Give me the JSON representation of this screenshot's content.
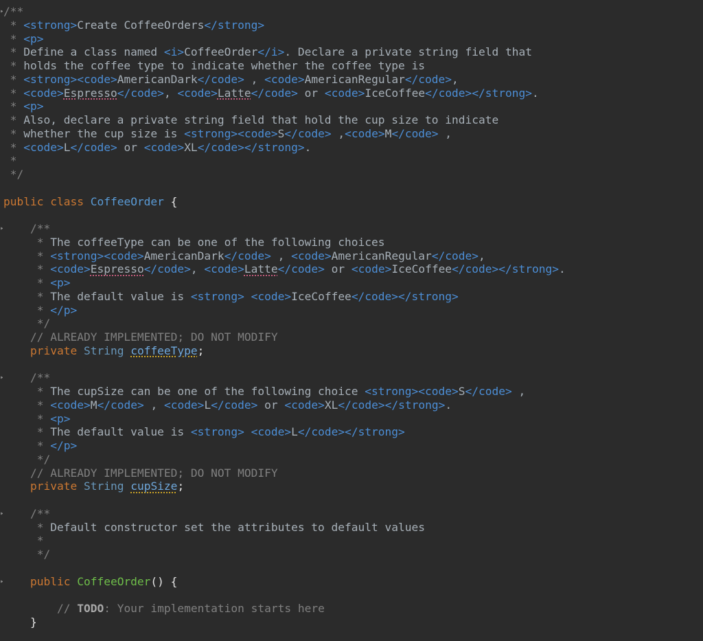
{
  "editor": {
    "lines": [
      "/**",
      " * <strong>Create CoffeeOrders</strong>",
      " * <p>",
      " * Define a class named <i>CoffeeOrder</i>. Declare a private string field that",
      " * holds the coffee type to indicate whether the coffee type is",
      " * <strong><code>AmericanDark</code> , <code>AmericanRegular</code>,",
      " * <code>Espresso</code>, <code>Latte</code> or <code>IceCoffee</code></strong>.",
      " * <p>",
      " * Also, declare a private string field that hold the cup size to indicate",
      " * whether the cup size is <strong><code>S</code> ,<code>M</code> ,",
      " * <code>L</code> or <code>XL</code></strong>.",
      " *",
      " */",
      "",
      "public class CoffeeOrder {",
      "",
      "    /**",
      "     * The coffeeType can be one of the following choices",
      "     * <strong><code>AmericanDark</code> , <code>AmericanRegular</code>,",
      "     * <code>Espresso</code>, <code>Latte</code> or <code>IceCoffee</code></strong>.",
      "     * <p>",
      "     * The default value is <strong> <code>IceCoffee</code></strong>",
      "     * </p>",
      "     */",
      "    // ALREADY IMPLEMENTED; DO NOT MODIFY",
      "    private String coffeeType;",
      "",
      "    /**",
      "     * The cupSize can be one of the following choice <strong><code>S</code> ,",
      "     * <code>M</code> , <code>L</code> or <code>XL</code></strong>.",
      "     * <p>",
      "     * The default value is <strong> <code>L</code></strong>",
      "     * </p>",
      "     */",
      "    // ALREADY IMPLEMENTED; DO NOT MODIFY",
      "    private String cupSize;",
      "",
      "    /**",
      "     * Default constructor set the attributes to default values",
      "     *",
      "     */",
      "",
      "    public CoffeeOrder() {",
      "",
      "        // TODO: Your implementation starts here",
      "    }"
    ]
  },
  "colors": {
    "background": "#2b2b2b",
    "comment": "#808080",
    "html_tag": "#4c8ed6",
    "keyword": "#cc7832",
    "type": "#6897bb",
    "class_name": "#5a9bd6",
    "method_name": "#6fbf4a",
    "field": "#6fa8dc",
    "text": "#e6e6e6"
  }
}
